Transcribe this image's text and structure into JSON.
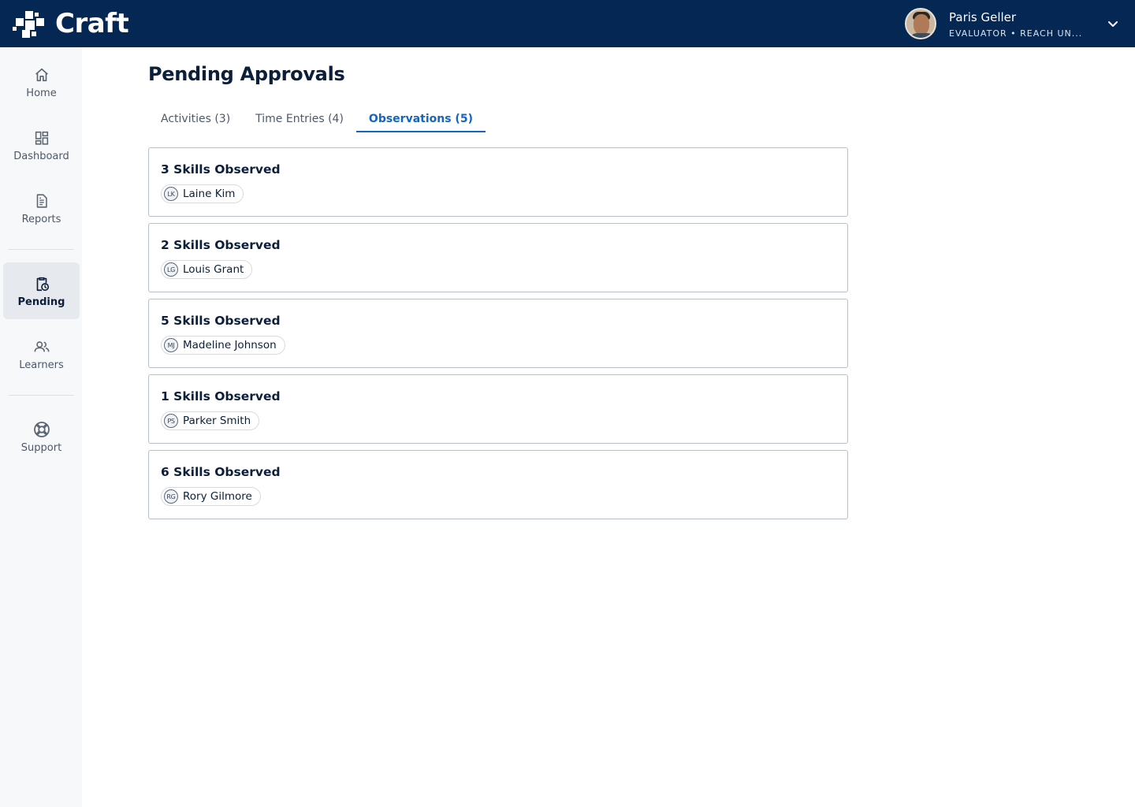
{
  "app": {
    "name": "Craft"
  },
  "user": {
    "name": "Paris Geller",
    "role": "EVALUATOR  •  REACH UN..."
  },
  "sidebar": {
    "items": [
      {
        "label": "Home",
        "icon": "home-icon"
      },
      {
        "label": "Dashboard",
        "icon": "dashboard-icon"
      },
      {
        "label": "Reports",
        "icon": "reports-icon"
      },
      {
        "label": "Pending",
        "icon": "pending-icon",
        "active": true
      },
      {
        "label": "Learners",
        "icon": "learners-icon"
      },
      {
        "label": "Support",
        "icon": "support-icon"
      }
    ]
  },
  "page": {
    "title": "Pending Approvals"
  },
  "tabs": [
    {
      "label": "Activities (3)"
    },
    {
      "label": "Time Entries (4)"
    },
    {
      "label": "Observations (5)",
      "active": true
    }
  ],
  "observations": [
    {
      "title": "3 Skills Observed",
      "initials": "LK",
      "name": "Laine Kim"
    },
    {
      "title": "2 Skills Observed",
      "initials": "LG",
      "name": "Louis Grant"
    },
    {
      "title": "5 Skills Observed",
      "initials": "MJ",
      "name": "Madeline Johnson"
    },
    {
      "title": "1 Skills Observed",
      "initials": "PS",
      "name": "Parker Smith"
    },
    {
      "title": "6 Skills Observed",
      "initials": "RG",
      "name": "Rory Gilmore"
    }
  ],
  "colors": {
    "topbar": "#052754",
    "accent": "#1565c0",
    "sidebar": "#f7f8fa"
  }
}
